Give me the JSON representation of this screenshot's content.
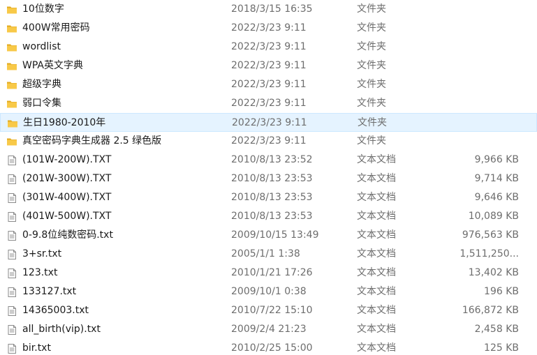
{
  "files": [
    {
      "name": "10位数字",
      "modified": "2018/3/15 16:35",
      "type": "文件夹",
      "size": "",
      "icon": "folder-icon",
      "selected": false
    },
    {
      "name": "400W常用密码",
      "modified": "2022/3/23 9:11",
      "type": "文件夹",
      "size": "",
      "icon": "folder-icon",
      "selected": false
    },
    {
      "name": "wordlist",
      "modified": "2022/3/23 9:11",
      "type": "文件夹",
      "size": "",
      "icon": "folder-icon",
      "selected": false
    },
    {
      "name": "WPA英文字典",
      "modified": "2022/3/23 9:11",
      "type": "文件夹",
      "size": "",
      "icon": "folder-icon",
      "selected": false
    },
    {
      "name": "超级字典",
      "modified": "2022/3/23 9:11",
      "type": "文件夹",
      "size": "",
      "icon": "folder-icon",
      "selected": false
    },
    {
      "name": "弱口令集",
      "modified": "2022/3/23 9:11",
      "type": "文件夹",
      "size": "",
      "icon": "folder-icon",
      "selected": false
    },
    {
      "name": "生日1980-2010年",
      "modified": "2022/3/23 9:11",
      "type": "文件夹",
      "size": "",
      "icon": "folder-icon",
      "selected": true
    },
    {
      "name": "真空密码字典生成器 2.5 绿色版",
      "modified": "2022/3/23 9:11",
      "type": "文件夹",
      "size": "",
      "icon": "folder-icon",
      "selected": false
    },
    {
      "name": "(101W-200W).TXT",
      "modified": "2010/8/13 23:52",
      "type": "文本文档",
      "size": "9,966 KB",
      "icon": "text-file-icon",
      "selected": false
    },
    {
      "name": "(201W-300W).TXT",
      "modified": "2010/8/13 23:53",
      "type": "文本文档",
      "size": "9,714 KB",
      "icon": "text-file-icon",
      "selected": false
    },
    {
      "name": "(301W-400W).TXT",
      "modified": "2010/8/13 23:53",
      "type": "文本文档",
      "size": "9,646 KB",
      "icon": "text-file-icon",
      "selected": false
    },
    {
      "name": "(401W-500W).TXT",
      "modified": "2010/8/13 23:53",
      "type": "文本文档",
      "size": "10,089 KB",
      "icon": "text-file-icon",
      "selected": false
    },
    {
      "name": "0-9.8位纯数密码.txt",
      "modified": "2009/10/15 13:49",
      "type": "文本文档",
      "size": "976,563 KB",
      "icon": "text-file-icon",
      "selected": false
    },
    {
      "name": "3+sr.txt",
      "modified": "2005/1/1 1:38",
      "type": "文本文档",
      "size": "1,511,250...",
      "icon": "text-file-icon",
      "selected": false
    },
    {
      "name": "123.txt",
      "modified": "2010/1/21 17:26",
      "type": "文本文档",
      "size": "13,402 KB",
      "icon": "text-file-icon",
      "selected": false
    },
    {
      "name": "133127.txt",
      "modified": "2009/10/1 0:38",
      "type": "文本文档",
      "size": "196 KB",
      "icon": "text-file-icon",
      "selected": false
    },
    {
      "name": "14365003.txt",
      "modified": "2010/7/22 15:10",
      "type": "文本文档",
      "size": "166,872 KB",
      "icon": "text-file-icon",
      "selected": false
    },
    {
      "name": "all_birth(vip).txt",
      "modified": "2009/2/4 21:23",
      "type": "文本文档",
      "size": "2,458 KB",
      "icon": "text-file-icon",
      "selected": false
    },
    {
      "name": "bir.txt",
      "modified": "2010/2/25 15:00",
      "type": "文本文档",
      "size": "125 KB",
      "icon": "text-file-icon",
      "selected": false
    }
  ],
  "colors": {
    "folder": "#f8c948",
    "folder_dark": "#e0a81e",
    "selection_bg": "#e5f3ff",
    "selection_border": "#cce8ff",
    "secondary_text": "#6d6d6d"
  }
}
